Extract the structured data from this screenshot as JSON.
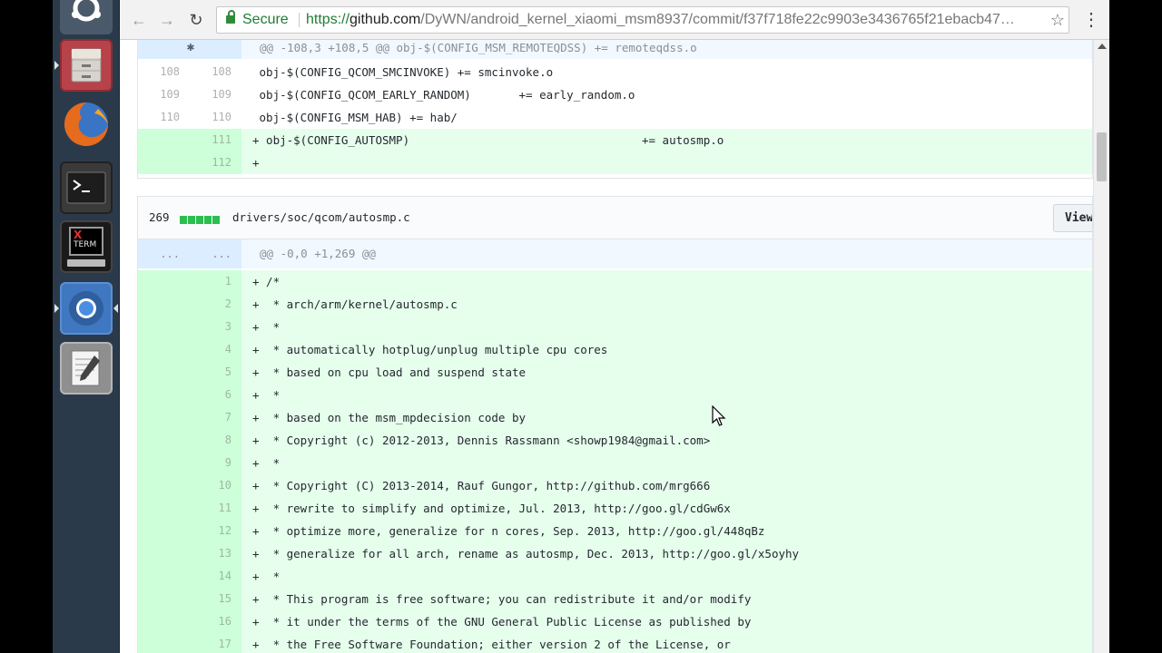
{
  "browser": {
    "secure_label": "Secure",
    "url_scheme": "https://",
    "url_host": "github.com",
    "url_path": "/DyWN/android_kernel_xiaomi_msm8937/commit/f37f718fe22c9903e3436765f21ebacb47…"
  },
  "file1": {
    "hunk_header": "@@ -108,3 +108,5 @@ obj-$(CONFIG_MSM_REMOTEQDSS) += remoteqdss.o",
    "lines": [
      {
        "old": "108",
        "new": "108",
        "text": " obj-$(CONFIG_QCOM_SMCINVOKE) += smcinvoke.o"
      },
      {
        "old": "109",
        "new": "109",
        "text": " obj-$(CONFIG_QCOM_EARLY_RANDOM)       += early_random.o"
      },
      {
        "old": "110",
        "new": "110",
        "text": " obj-$(CONFIG_MSM_HAB) += hab/"
      },
      {
        "old": "",
        "new": "111",
        "text": "+ obj-$(CONFIG_AUTOSMP)                                  += autosmp.o"
      },
      {
        "old": "",
        "new": "112",
        "text": "+"
      }
    ]
  },
  "file2": {
    "count": "269",
    "path": "drivers/soc/qcom/autosmp.c",
    "view_label": "View",
    "hunk_old": "...",
    "hunk_new": "...",
    "hunk_header": "@@ -0,0 +1,269 @@",
    "lines": [
      {
        "new": "1",
        "text": "+ /*"
      },
      {
        "new": "2",
        "text": "+  * arch/arm/kernel/autosmp.c"
      },
      {
        "new": "3",
        "text": "+  *"
      },
      {
        "new": "4",
        "text": "+  * automatically hotplug/unplug multiple cpu cores"
      },
      {
        "new": "5",
        "text": "+  * based on cpu load and suspend state"
      },
      {
        "new": "6",
        "text": "+  *"
      },
      {
        "new": "7",
        "text": "+  * based on the msm_mpdecision code by"
      },
      {
        "new": "8",
        "text": "+  * Copyright (c) 2012-2013, Dennis Rassmann <showp1984@gmail.com>"
      },
      {
        "new": "9",
        "text": "+  *"
      },
      {
        "new": "10",
        "text": "+  * Copyright (C) 2013-2014, Rauf Gungor, http://github.com/mrg666"
      },
      {
        "new": "11",
        "text": "+  * rewrite to simplify and optimize, Jul. 2013, http://goo.gl/cdGw6x"
      },
      {
        "new": "12",
        "text": "+  * optimize more, generalize for n cores, Sep. 2013, http://goo.gl/448qBz"
      },
      {
        "new": "13",
        "text": "+  * generalize for all arch, rename as autosmp, Dec. 2013, http://goo.gl/x5oyhy"
      },
      {
        "new": "14",
        "text": "+  *"
      },
      {
        "new": "15",
        "text": "+  * This program is free software; you can redistribute it and/or modify"
      },
      {
        "new": "16",
        "text": "+  * it under the terms of the GNU General Public License as published by"
      },
      {
        "new": "17",
        "text": "+  * the Free Software Foundation; either version 2 of the License, or"
      }
    ]
  },
  "launcher": [
    "files-icon",
    "firefox-icon",
    "terminal-icon",
    "xterm-icon",
    "chromium-icon",
    "text-editor-icon"
  ],
  "xterm_label_x": "X",
  "xterm_label_term": "TERM",
  "colors": {
    "add_bg": "#e6ffed",
    "add_gutter": "#cdffd8",
    "hunk_bg": "#f1f8ff",
    "hunk_gutter": "#dbedff",
    "secure": "#1e7d32"
  }
}
